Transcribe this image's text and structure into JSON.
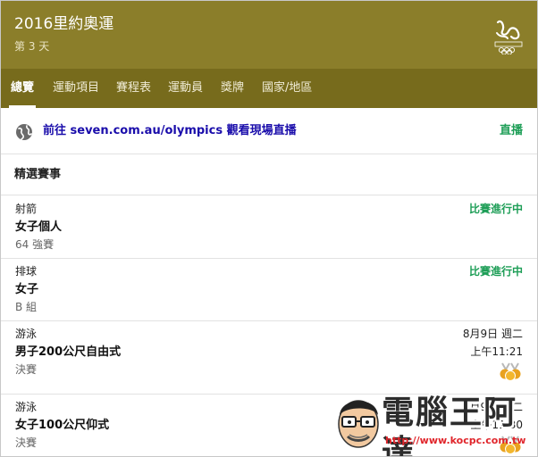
{
  "header": {
    "title": "2016里約奧運",
    "subtitle": "第 3 天",
    "logo_icon": "rio2016-olympic-rings-logo"
  },
  "tabs": [
    {
      "label": "總覽",
      "active": true
    },
    {
      "label": "運動項目",
      "active": false
    },
    {
      "label": "賽程表",
      "active": false
    },
    {
      "label": "運動員",
      "active": false
    },
    {
      "label": "獎牌",
      "active": false
    },
    {
      "label": "國家/地區",
      "active": false
    }
  ],
  "live": {
    "icon": "globe-icon",
    "link_text": "前往 seven.com.au/olympics 觀看現場直播",
    "label": "直播"
  },
  "featured": {
    "title": "精選賽事",
    "events": [
      {
        "sport": "射箭",
        "name": "女子個人",
        "round": "64 強賽",
        "status": "比賽進行中"
      },
      {
        "sport": "排球",
        "name": "女子",
        "round": "B 組",
        "status": "比賽進行中"
      },
      {
        "sport": "游泳",
        "name": "男子200公尺自由式",
        "round": "決賽",
        "date": "8月9日 週二",
        "time": "上午11:21",
        "icon": "medal-icon"
      },
      {
        "sport": "游泳",
        "name": "女子100公尺仰式",
        "round": "決賽",
        "date": "8月9日 週二",
        "time": "上午11:30",
        "icon": "medal-icon"
      }
    ]
  },
  "watermark": {
    "text": "電腦王阿達",
    "url": "http://www.kocpc.com.tw"
  },
  "colors": {
    "header_bg": "#8b7e2a",
    "tabs_bg": "#776b1c",
    "link": "#1a0dab",
    "live_green": "#1e9e57"
  }
}
